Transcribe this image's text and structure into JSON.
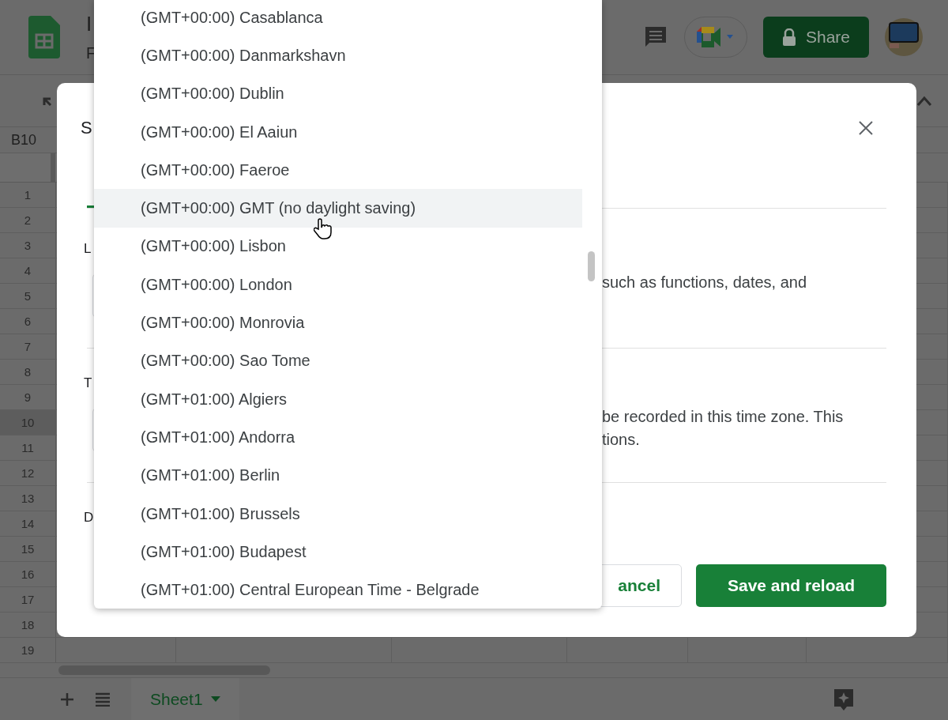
{
  "app": {
    "title_fragment": "I",
    "menu_fragment": "F",
    "share_label": "Share",
    "name_box": "B10",
    "rows": [
      {
        "label": "1",
        "selected": false
      },
      {
        "label": "2",
        "selected": false
      },
      {
        "label": "3",
        "selected": false
      },
      {
        "label": "4",
        "selected": false
      },
      {
        "label": "5",
        "selected": false
      },
      {
        "label": "6",
        "selected": false
      },
      {
        "label": "7",
        "selected": false
      },
      {
        "label": "8",
        "selected": false
      },
      {
        "label": "9",
        "selected": false
      },
      {
        "label": "10",
        "selected": true
      },
      {
        "label": "11",
        "selected": false
      },
      {
        "label": "12",
        "selected": false
      },
      {
        "label": "13",
        "selected": false
      },
      {
        "label": "14",
        "selected": false
      },
      {
        "label": "15",
        "selected": false
      },
      {
        "label": "16",
        "selected": false
      },
      {
        "label": "17",
        "selected": false
      },
      {
        "label": "18",
        "selected": false
      },
      {
        "label": "19",
        "selected": false
      }
    ],
    "sheet_tabs": [
      {
        "label": "Sheet1",
        "selected": true
      }
    ]
  },
  "dialog": {
    "title_fragment": "S",
    "tabs": [
      {
        "selected": true
      }
    ],
    "sections": [
      {
        "label": "L",
        "text_lines": [
          "such as functions, dates, and"
        ]
      },
      {
        "label": "T",
        "text_lines": [
          "be recorded in this time zone. This",
          "tions."
        ]
      },
      {
        "label": "D"
      }
    ],
    "buttons": [
      {
        "label": "ancel",
        "kind": "secondary"
      },
      {
        "label": "Save and reload",
        "kind": "primary"
      }
    ]
  },
  "timezone_menu": {
    "options": [
      {
        "label": "(GMT+00:00) Casablanca",
        "hovered": false
      },
      {
        "label": "(GMT+00:00) Danmarkshavn",
        "hovered": false
      },
      {
        "label": "(GMT+00:00) Dublin",
        "hovered": false
      },
      {
        "label": "(GMT+00:00) El Aaiun",
        "hovered": false
      },
      {
        "label": "(GMT+00:00) Faeroe",
        "hovered": false
      },
      {
        "label": "(GMT+00:00) GMT (no daylight saving)",
        "hovered": true
      },
      {
        "label": "(GMT+00:00) Lisbon",
        "hovered": false
      },
      {
        "label": "(GMT+00:00) London",
        "hovered": false
      },
      {
        "label": "(GMT+00:00) Monrovia",
        "hovered": false
      },
      {
        "label": "(GMT+00:00) Sao Tome",
        "hovered": false
      },
      {
        "label": "(GMT+01:00) Algiers",
        "hovered": false
      },
      {
        "label": "(GMT+01:00) Andorra",
        "hovered": false
      },
      {
        "label": "(GMT+01:00) Berlin",
        "hovered": false
      },
      {
        "label": "(GMT+01:00) Brussels",
        "hovered": false
      },
      {
        "label": "(GMT+01:00) Budapest",
        "hovered": false
      },
      {
        "label": "(GMT+01:00) Central European Time - Belgrade",
        "hovered": false
      }
    ]
  }
}
